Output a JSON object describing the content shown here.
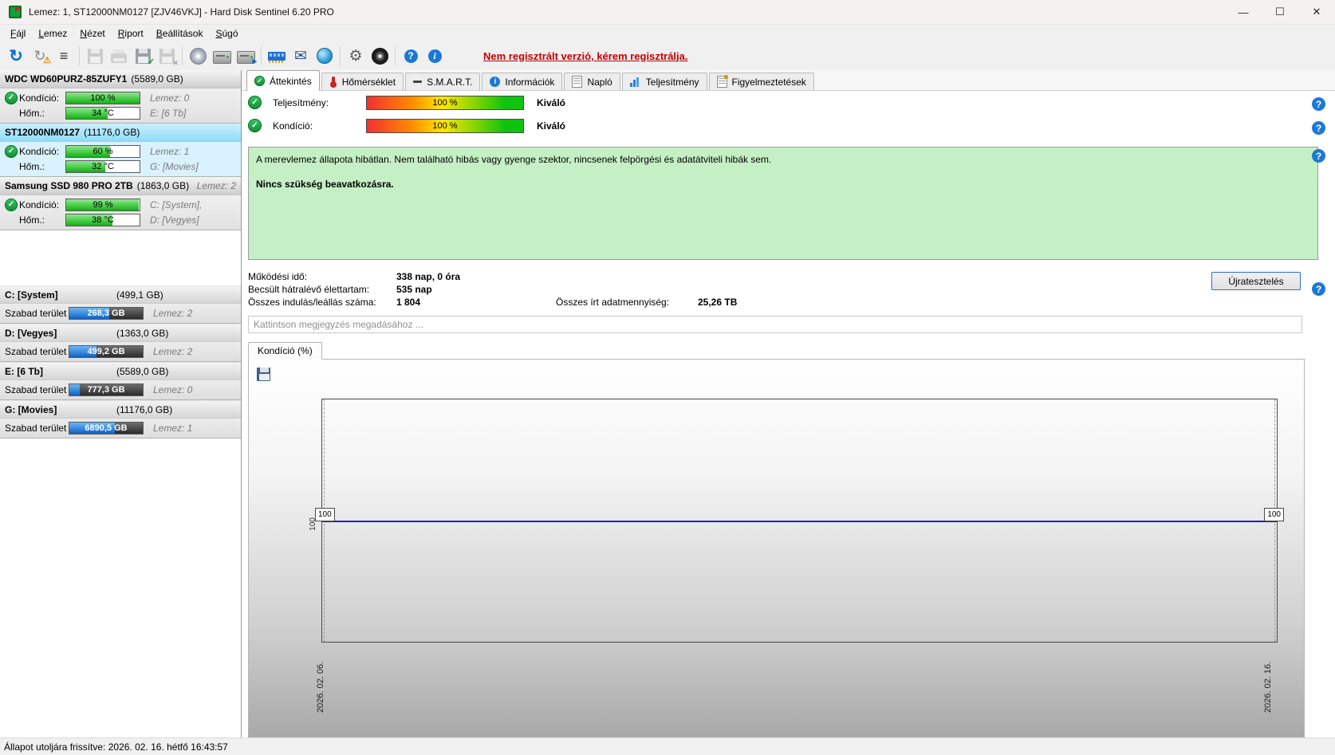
{
  "window": {
    "title": "Lemez: 1, ST12000NM0127 [ZJV46VKJ]  -  Hard Disk Sentinel 6.20 PRO",
    "minimize": "—",
    "maximize": "☐",
    "close": "✕"
  },
  "menu": {
    "items": [
      "Fájl",
      "Lemez",
      "Nézet",
      "Riport",
      "Beállítások",
      "Súgó"
    ]
  },
  "toolbar": {
    "register_notice": "Nem regisztrált verzió, kérem regisztrálja."
  },
  "icons": {
    "refresh": "↻",
    "warning": "⚠",
    "report": "≡",
    "check": "✓",
    "close": "✕",
    "arrow": "▸",
    "mail": "✉",
    "gear": "⚙",
    "help": "?",
    "info": "i"
  },
  "sidebar": {
    "disks": [
      {
        "name": "WDC WD60PURZ-85ZUFY1",
        "capacity": "(5589,0 GB)",
        "condition_label": "Kondíció:",
        "condition_value": "100 %",
        "condition_pct": 100,
        "disk_no": "Lemez: 0",
        "temp_label": "Hőm.:",
        "temp_value": "34 °C",
        "temp_pct": 57,
        "drives": "E: [6 Tb]"
      },
      {
        "name": "ST12000NM0127",
        "capacity": "(11176,0 GB)",
        "condition_label": "Kondíció:",
        "condition_value": "60 %",
        "condition_pct": 60,
        "disk_no": "Lemez: 1",
        "temp_label": "Hőm.:",
        "temp_value": "32 °C",
        "temp_pct": 53,
        "drives": "G: [Movies]"
      },
      {
        "name": "Samsung SSD 980 PRO 2TB",
        "capacity": "(1863,0 GB)",
        "header_right": "Lemez: 2",
        "condition_label": "Kondíció:",
        "condition_value": "99 %",
        "condition_pct": 99,
        "disk_no": "C: [System],",
        "temp_label": "Hőm.:",
        "temp_value": "38 °C",
        "temp_pct": 63,
        "drives": "D: [Vegyes]"
      }
    ],
    "partitions": [
      {
        "name": "C: [System]",
        "capacity": "(499,1 GB)",
        "free_label": "Szabad terület",
        "free_value": "268,3 GB",
        "free_pct": 54,
        "disk_no": "Lemez: 2"
      },
      {
        "name": "D: [Vegyes]",
        "capacity": "(1363,0 GB)",
        "free_label": "Szabad terület",
        "free_value": "499,2 GB",
        "free_pct": 37,
        "disk_no": "Lemez: 2"
      },
      {
        "name": "E: [6 Tb]",
        "capacity": "(5589,0 GB)",
        "free_label": "Szabad terület",
        "free_value": "777,3 GB",
        "free_pct": 14,
        "disk_no": "Lemez: 0"
      },
      {
        "name": "G: [Movies]",
        "capacity": "(11176,0 GB)",
        "free_label": "Szabad terület",
        "free_value": "6890,5 GB",
        "free_pct": 62,
        "disk_no": "Lemez: 1"
      }
    ]
  },
  "tabs": [
    {
      "label": "Áttekintés"
    },
    {
      "label": "Hőmérséklet"
    },
    {
      "label": "S.M.A.R.T."
    },
    {
      "label": "Információk"
    },
    {
      "label": "Napló"
    },
    {
      "label": "Teljesítmény"
    },
    {
      "label": "Figyelmeztetések"
    }
  ],
  "overview": {
    "performance_label": "Teljesítmény:",
    "performance_value": "100 %",
    "performance_pct": 100,
    "performance_rating": "Kiváló",
    "condition_label": "Kondíció:",
    "condition_value": "100 %",
    "condition_pct": 100,
    "condition_rating": "Kiváló",
    "status_text": "A merevlemez állapota hibátlan. Nem található hibás vagy gyenge szektor, nincsenek felpörgési és adatátviteli hibák sem.",
    "status_bold": "Nincs szükség beavatkozásra.",
    "stats": [
      {
        "label": "Működési idő:",
        "value": "338 nap, 0 óra"
      },
      {
        "label": "Becsült hátralévő élettartam:",
        "value": "535 nap"
      },
      {
        "label": "Összes indulás/leállás száma:",
        "value": "1 804"
      }
    ],
    "written_label": "Összes írt adatmennyiség:",
    "written_value": "25,26 TB",
    "retest_button": "Újratesztelés",
    "comment_placeholder": "Kattintson megjegyzés megadásához ..."
  },
  "chart_data": {
    "type": "line",
    "title": "Kondíció  (%)",
    "x": [
      "2026. 02. 06.",
      "2026. 02. 16."
    ],
    "series": [
      {
        "name": "Kondíció (%)",
        "values": [
          100,
          100
        ]
      }
    ],
    "ylim": [
      0,
      100
    ],
    "y_ticks": [
      "100"
    ],
    "point_labels": [
      "100",
      "100"
    ],
    "line_color": "#2121c8",
    "grid": "off",
    "legend": "none"
  },
  "statusbar": {
    "text": "Állapot utoljára frissítve: 2026. 02. 16. hétfő 16:43:57"
  }
}
